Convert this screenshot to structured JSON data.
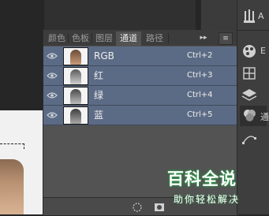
{
  "panel": {
    "tabs": [
      {
        "label": "颜色",
        "active": false
      },
      {
        "label": "色板",
        "active": false
      },
      {
        "label": "图层",
        "active": false
      },
      {
        "label": "通道",
        "active": true
      },
      {
        "label": "路径",
        "active": false
      }
    ],
    "collapse_glyph": "▸▸",
    "menu_glyph": "≡"
  },
  "channels": [
    {
      "name": "RGB",
      "shortcut": "Ctrl+2",
      "visible": true
    },
    {
      "name": "红",
      "shortcut": "Ctrl+3",
      "visible": true
    },
    {
      "name": "绿",
      "shortcut": "Ctrl+4",
      "visible": true
    },
    {
      "name": "蓝",
      "shortcut": "Ctrl+5",
      "visible": true
    }
  ],
  "dock": {
    "items": [
      {
        "icon": "brush-settings-icon",
        "label": ""
      },
      {
        "icon": "character-icon",
        "label": "A"
      },
      {
        "icon": "styles-icon",
        "label": "E"
      },
      {
        "icon": "grid-icon",
        "label": ""
      },
      {
        "icon": "layers-icon",
        "label": ""
      },
      {
        "icon": "channels-icon",
        "label": "通"
      },
      {
        "icon": "paths-icon",
        "label": ""
      }
    ]
  },
  "watermark": {
    "title": "百科全说",
    "subtitle": "助你轻松解决",
    "color": "#2aa34a"
  },
  "colors": {
    "selected_row": "#5c6b85",
    "panel_bg": "#535353"
  }
}
